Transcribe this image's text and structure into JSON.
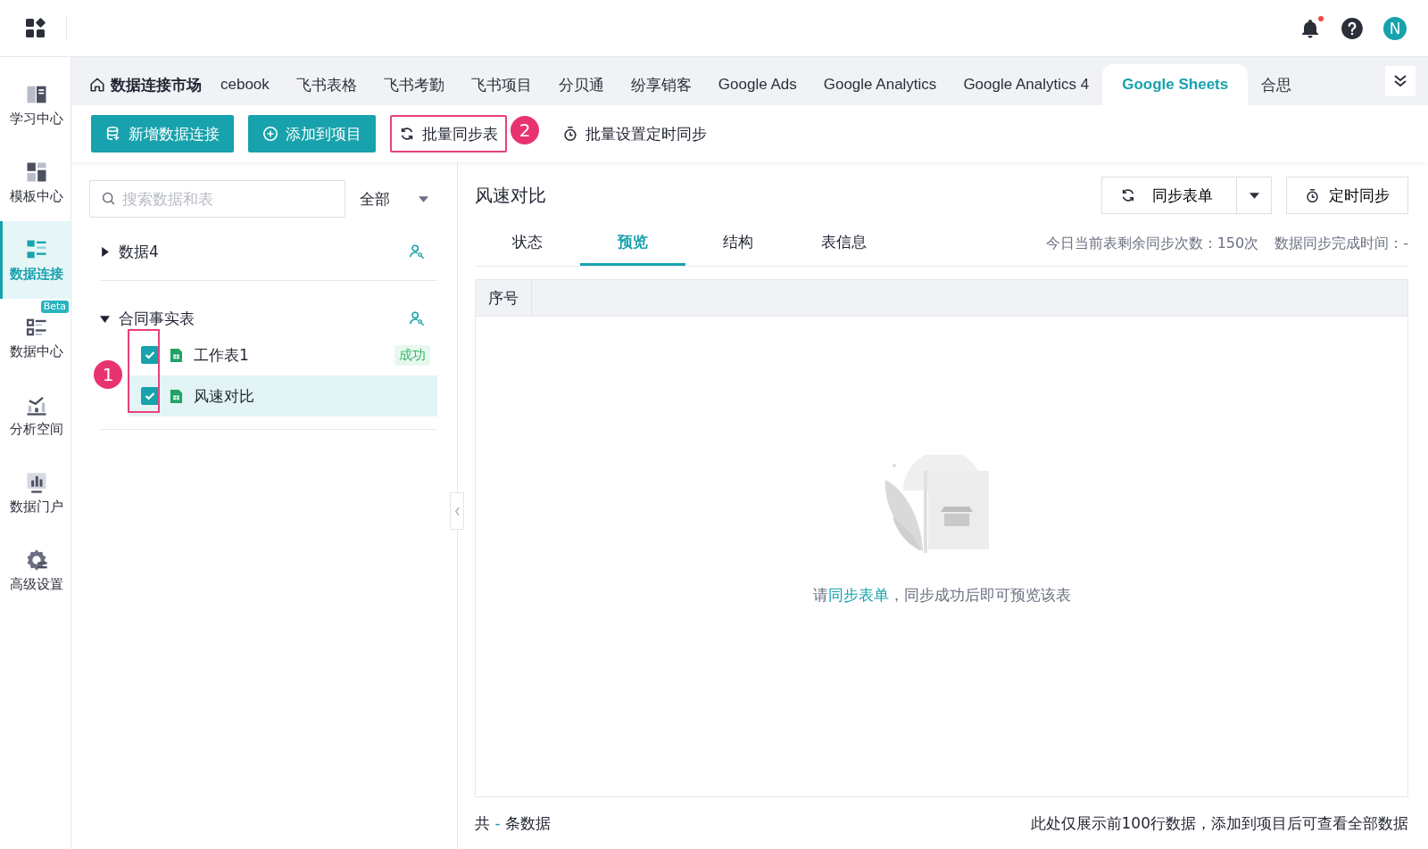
{
  "nav": [
    {
      "label": "学习中心",
      "selected": false
    },
    {
      "label": "模板中心",
      "selected": false
    },
    {
      "label": "数据连接",
      "selected": true
    },
    {
      "label": "数据中心",
      "selected": false,
      "badge": "Beta"
    },
    {
      "label": "分析空间",
      "selected": false
    },
    {
      "label": "数据门户",
      "selected": false
    },
    {
      "label": "高级设置",
      "selected": false
    }
  ],
  "top_bar": {
    "avatar": "N",
    "notification": true
  },
  "market_tab": {
    "label": "数据连接市场"
  },
  "source_tabs": [
    {
      "label": "cebook",
      "selected": false
    },
    {
      "label": "飞书表格",
      "selected": false
    },
    {
      "label": "飞书考勤",
      "selected": false
    },
    {
      "label": "飞书项目",
      "selected": false
    },
    {
      "label": "分贝通",
      "selected": false
    },
    {
      "label": "纷享销客",
      "selected": false
    },
    {
      "label": "Google Ads",
      "selected": false
    },
    {
      "label": "Google Analytics",
      "selected": false
    },
    {
      "label": "Google Analytics 4",
      "selected": false
    },
    {
      "label": "Google Sheets",
      "selected": true
    },
    {
      "label": "合思",
      "selected": false
    }
  ],
  "toolbar": [
    {
      "label": "新增数据连接",
      "kind": "primary"
    },
    {
      "label": "添加到项目",
      "kind": "primary"
    },
    {
      "label": "批量同步表",
      "kind": "plain",
      "highlighted": true,
      "marker": "2"
    },
    {
      "label": "批量设置定时同步",
      "kind": "plain",
      "highlighted": false
    }
  ],
  "search": {
    "placeholder": "搜索数据和表"
  },
  "filter": {
    "value": "全部"
  },
  "tree": [
    {
      "label": "数据4",
      "expanded": false
    },
    {
      "label": "合同事实表",
      "expanded": true,
      "children": [
        {
          "label": "工作表1",
          "checked": true,
          "selected": false,
          "status": "成功"
        },
        {
          "label": "风速对比",
          "checked": true,
          "selected": true
        }
      ]
    }
  ],
  "checkbox_marker": "1",
  "detail": {
    "title": "风速对比",
    "sync_button": "同步表单",
    "schedule_button": "定时同步",
    "tabs": [
      {
        "label": "状态",
        "selected": false
      },
      {
        "label": "预览",
        "selected": true
      },
      {
        "label": "结构",
        "selected": false
      },
      {
        "label": "表信息",
        "selected": false
      }
    ],
    "remaining": "今日当前表剩余同步次数：150次",
    "finished": "数据同步完成时间：-",
    "columns": [
      "序号"
    ],
    "empty": {
      "prefix": "请",
      "link": "同步表单",
      "suffix": "，同步成功后即可预览该表"
    },
    "footer_count": {
      "prefix": "共",
      "count": "-",
      "suffix": "条数据"
    },
    "footer_note": "此处仅展示前100行数据，添加到项目后可查看全部数据"
  }
}
